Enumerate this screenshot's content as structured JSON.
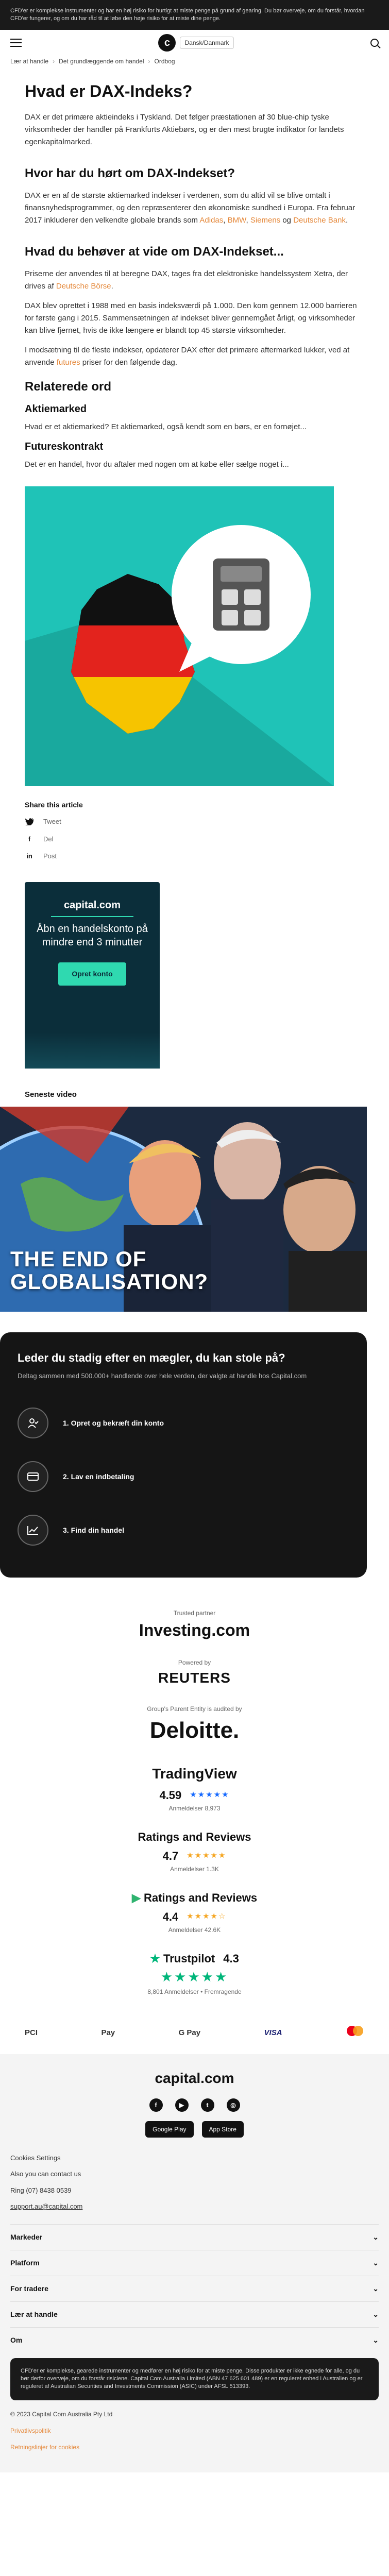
{
  "risk_banner": "CFD'er er komplekse instrumenter og har en høj risiko for hurtigt at miste penge på grund af gearing. Du bør overveje, om du forstår, hvordan CFD'er fungerer, og om du har råd til at løbe den høje risiko for at miste dine penge.",
  "header": {
    "logo_letter": "c",
    "language": "Dansk/Danmark"
  },
  "breadcrumb": [
    "Lær at handle",
    "Det grundlæggende om handel",
    "Ordbog"
  ],
  "article": {
    "title": "Hvad er DAX-Indeks?",
    "intro": "DAX er det primære aktieindeks i Tyskland. Det følger præstationen af 30 blue-chip tyske virksomheder der handler på Frankfurts Aktiebørs, og er den mest brugte indikator for landets egenkapitalmarked.",
    "h_heard": "Hvor har du hørt om DAX-Indekset?",
    "heard_text": "DAX er en af de største aktiemarked indekser i verdenen, som du altid vil se blive omtalt i finansnyhedsprogrammer, og den repræsenterer den økonomiske sundhed i Europa. Fra februar 2017 inkluderer den velkendte globale brands som",
    "heard_links": [
      "Adidas",
      "BMW",
      "Siemens",
      "Deutsche Bank"
    ],
    "h_need": "Hvad du behøver at vide om DAX-Indekset...",
    "need_p1": "Priserne der anvendes til at beregne DAX, tages fra det elektroniske handelssystem Xetra, der drives af",
    "need_p1_link": "Deutsche Börse",
    "need_p2": "DAX blev oprettet i 1988 med en basis indeksværdi på 1.000. Den kom gennem 12.000 barrieren for første gang i 2015. Sammensætningen af indekset bliver gennemgået årligt, og virksomheder kan blive fjernet, hvis de ikke længere er blandt top 45 største virksomheder.",
    "need_p3": "I modsætning til de fleste indekser, opdaterer DAX efter det primære aftermarked lukker, ved at anvende",
    "need_p3_link": "futures",
    "need_p3_end": "priser for den følgende dag.",
    "h_related": "Relaterede ord",
    "h_stock": "Aktiemarked",
    "stock_text": "Hvad er et aktiemarked? Et aktiemarked, også kendt som en børs, er en fornøjet...",
    "h_futures": "Futureskontrakt",
    "futures_text": "Det er en handel, hvor du aftaler med nogen om at købe eller sælge noget i..."
  },
  "share": {
    "title": "Share this article",
    "items": [
      "Tweet",
      "Del",
      "Post"
    ]
  },
  "promo": {
    "logo": "capital.com",
    "text": "Åbn en handelskonto på mindre end 3 minutter",
    "button": "Opret konto"
  },
  "video": {
    "title": "Seneste video",
    "caption_line1": "THE END OF",
    "caption_line2": "GLOBALISATION?"
  },
  "cta": {
    "title": "Leder du stadig efter en mægler, du kan stole på?",
    "subtitle": "Deltag sammen med 500.000+ handlende over hele verden, der valgte at handle hos Capital.com",
    "steps": [
      "1. Opret og bekræft din konto",
      "2. Lav en indbetaling",
      "3. Find din handel"
    ]
  },
  "trust": {
    "partner_label": "Trusted partner",
    "partner": "Investing.com",
    "powered_label": "Powered by",
    "powered": "REUTERS",
    "audited_label": "Group's Parent Entity is audited by",
    "auditor": "Deloitte.",
    "tv_name": "TradingView",
    "tv_rating": "4.59",
    "tv_reviews": "Anmeldelser 8,973",
    "apple_name": "Ratings and Reviews",
    "apple_rating": "4.7",
    "apple_reviews": "Anmeldelser 1.3K",
    "google_name": "Ratings and Reviews",
    "google_rating": "4.4",
    "google_reviews": "Anmeldelser 42.6K",
    "tp_name": "Trustpilot",
    "tp_rating": "4.3",
    "tp_reviews": "8,801 Anmeldelser • Fremragende"
  },
  "payments": [
    "PCI",
    "Pay",
    "G Pay",
    "VISA",
    "MC"
  ],
  "footer": {
    "logo": "capital.com",
    "stores": [
      "Google Play",
      "App Store"
    ],
    "cookie": "Cookies Settings",
    "contact_label": "Also you can contact us",
    "phone": "Ring (07) 8438 0539",
    "email": "support.au@capital.com",
    "sections": [
      "Markeder",
      "Platform",
      "For tradere",
      "Lær at handle",
      "Om"
    ],
    "legal": "CFD'er er komplekse, gearede instrumenter og medfører en høj risiko for at miste penge. Disse produkter er ikke egnede for alle, og du bør derfor overveje, om du forstår risiciene. Capital Com Australia Limited (ABN 47 625 601 489) er en reguleret enhed i Australien og er reguleret af Australian Securities and Investments Commission (ASIC) under AFSL 513393.",
    "copyright": "© 2023 Capital Com Australia Pty Ltd",
    "bottom_links": [
      "Privatlivspolitik",
      "Retningslinjer for cookies"
    ]
  },
  "colors": {
    "accent": "#e5883a",
    "teal": "#1fc3b7",
    "promo_bg": "#0b2e3a",
    "promo_accent": "#2fd9b0",
    "cta_bg": "#151515"
  }
}
